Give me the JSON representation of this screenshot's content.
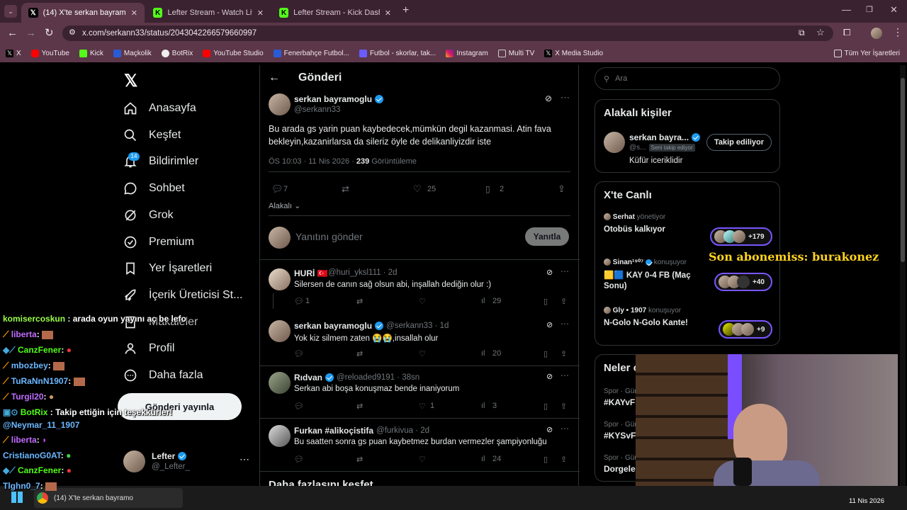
{
  "browser": {
    "tabs": [
      {
        "title": "(14) X'te serkan bayramoglu: \"B",
        "active": true
      },
      {
        "title": "Lefter Stream - Watch Live on K",
        "active": false
      },
      {
        "title": "Lefter Stream - Kick Dashboard",
        "active": false
      }
    ],
    "url": "x.com/serkann33/status/2043042266579660997",
    "bookmarks": [
      "X",
      "YouTube",
      "Kick",
      "Maçkolik",
      "BotRix",
      "YouTube Studio",
      "Fenerbahçe Futbol...",
      "Futbol - skorlar, tak...",
      "Instagram",
      "Multi TV",
      "X Media Studio"
    ],
    "all_bookmarks": "Tüm Yer İşaretleri"
  },
  "nav": {
    "items": [
      "Anasayfa",
      "Keşfet",
      "Bildirimler",
      "Sohbet",
      "Grok",
      "Premium",
      "Yer İşaretleri",
      "İçerik Üreticisi St...",
      "Makaleler",
      "Profil",
      "Daha fazla"
    ],
    "notif_badge": "14",
    "post_button": "Gönderi yayınla",
    "account_name": "Lefter",
    "account_handle": "@_Lefter_"
  },
  "post": {
    "header": "Gönderi",
    "author": "serkan bayramoglu",
    "handle": "@serkann33",
    "text": "Bu arada gs yarin puan kaybedecek,mümkün degil kazanmasi. Atin fava bekleyin,kazanirlarsa da sileriz öyle de delikanliyizdir iste",
    "time": "ÖS 10:03 · 11 Nis 2026 · ",
    "views": "239",
    "views_label": " Görüntüleme",
    "replies": "7",
    "likes": "25",
    "bookmarks": "2",
    "sort": "Alakalı",
    "reply_placeholder": "Yanıtını gönder",
    "reply_button": "Yanıtla"
  },
  "replies": [
    {
      "name": "HURİ 🇹🇷",
      "handle": "@huri_yksl111 · 2d",
      "text": "Silersen de canın sağ olsun abi, inşallah dediğin olur :)",
      "replies": "1",
      "likes": "",
      "views": "29"
    },
    {
      "name": "serkan bayramoglu",
      "handle": "@serkann33 · 1d",
      "text": "Yok kiz silmem zaten 😭😭,insallah olur",
      "replies": "",
      "likes": "",
      "views": "20"
    },
    {
      "name": "Rıdvan",
      "handle": "@reloaded9191 · 38sn",
      "text": "Serkan abi boşa konuşmaz bende inaniyorum",
      "replies": "",
      "likes": "1",
      "views": "3"
    },
    {
      "name": "Furkan #alikoçistifa",
      "handle": "@furkivua · 2d",
      "text": "Bu saatten sonra gs puan kaybetmez burdan vermezler şampiyonluğu",
      "replies": "",
      "likes": "",
      "views": "24"
    }
  ],
  "more": "Daha fazlasını keşfet",
  "right": {
    "search_placeholder": "Ara",
    "relevant_title": "Alakalı kişiler",
    "rel_name": "serkan bayra...",
    "rel_handle": "@s...",
    "follows_you": "Seni takip ediyor",
    "following_btn": "Takip ediliyor",
    "rel_bio": "Küfür iceriklidir",
    "live_title": "X'te Canlı",
    "lives": [
      {
        "host": "Serhat",
        "role": " yönetiyor",
        "title": "Otobüs kalkıyor",
        "count": "+179"
      },
      {
        "host": "Sinan¹⁹⁰⁷",
        "role": " konuşuyor",
        "title": "🟨🟦 KAY 0-4 FB (Maç Sonu)",
        "count": "+40"
      },
      {
        "host": "Gly • 1907",
        "role": " konuşuyor",
        "title": "N-Golo N-Golo Kante!",
        "count": "+9"
      }
    ],
    "trends_title": "Neler o",
    "trends": [
      {
        "meta": "Spor · Gün",
        "tag": "#KAYvFB"
      },
      {
        "meta": "Spor · Gün",
        "tag": "#KYSvFB"
      },
      {
        "meta": "Spor · Gün",
        "tag": "Dorgeles"
      }
    ]
  },
  "overlay": {
    "sub_alert": "Son abonemiss: burakonez",
    "chat": [
      {
        "user": "komisercoskun",
        "msg": ": arada oyun yayını aç be lefo",
        "color": "#9bff4a"
      },
      {
        "user": "liberta",
        "msg": ":",
        "color": "#c06cff"
      },
      {
        "user": "CanzFener",
        "msg": ":",
        "color": "#53fc18"
      },
      {
        "user": "mbozbey",
        "msg": ":",
        "color": "#6ab7ff"
      },
      {
        "user": "TuRaNnN1907",
        "msg": ":",
        "color": "#6ab7ff"
      },
      {
        "user": "Turgil20",
        "msg": ":",
        "color": "#c06cff"
      },
      {
        "user": "BotRix",
        "msg": ": Takip ettiğin için teşekkürler!",
        "color": "#53fc18"
      },
      {
        "user": "@Neymar_11_1907",
        "msg": "",
        "color": "#6ab7ff"
      },
      {
        "user": "liberta",
        "msg": ":",
        "color": "#c06cff"
      },
      {
        "user": "CristianoG0AT",
        "msg": ":",
        "color": "#6ab7ff"
      },
      {
        "user": "CanzFener",
        "msg": ":",
        "color": "#53fc18"
      },
      {
        "user": "Tlghn0_7",
        "msg": ":",
        "color": "#6ab7ff"
      }
    ],
    "taskbar_item": "(14) X'te serkan bayramo",
    "clock": "11 Nis 2026"
  }
}
